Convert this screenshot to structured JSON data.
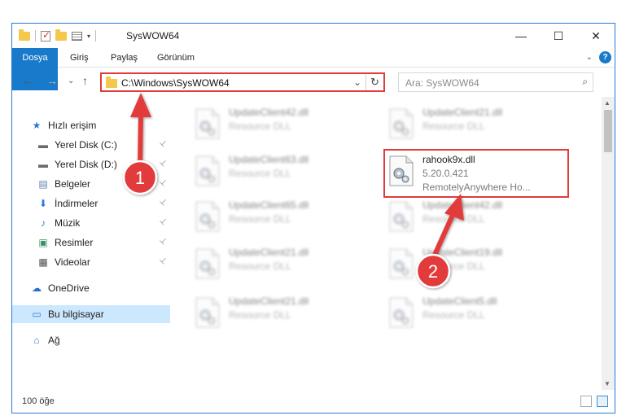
{
  "window": {
    "title": "SysWOW64",
    "controls": {
      "minimize": "—",
      "maximize": "☐",
      "close": "✕"
    }
  },
  "ribbon": {
    "tabs": [
      "Dosya",
      "Giriş",
      "Paylaş",
      "Görünüm"
    ],
    "expand_glyph": "⌄",
    "help_glyph": "?"
  },
  "nav": {
    "back": "←",
    "forward": "→",
    "recent": "⌄",
    "up": "↑"
  },
  "address": {
    "path": "C:\\Windows\\SysWOW64",
    "dropdown": "⌄",
    "refresh": "↻"
  },
  "search": {
    "placeholder": "Ara: SysWOW64",
    "icon": "⌕"
  },
  "sidebar": {
    "items": [
      {
        "label": "Hızlı erişim",
        "icon": "star-icon",
        "glyph": "★",
        "color": "#2b79d8",
        "pinned": false
      },
      {
        "label": "Yerel Disk (C:)",
        "icon": "drive-icon",
        "glyph": "▬",
        "color": "#6a6a6a",
        "pinned": true
      },
      {
        "label": "Yerel Disk (D:)",
        "icon": "drive-icon",
        "glyph": "▬",
        "color": "#6a6a6a",
        "pinned": true
      },
      {
        "label": "Belgeler",
        "icon": "documents-icon",
        "glyph": "▤",
        "color": "#5a7fb0",
        "pinned": true
      },
      {
        "label": "İndirmeler",
        "icon": "download-icon",
        "glyph": "⬇",
        "color": "#2b79d8",
        "pinned": true
      },
      {
        "label": "Müzik",
        "icon": "music-icon",
        "glyph": "♪",
        "color": "#2b79d8",
        "pinned": true
      },
      {
        "label": "Resimler",
        "icon": "pictures-icon",
        "glyph": "▣",
        "color": "#3b8f6a",
        "pinned": true
      },
      {
        "label": "Videolar",
        "icon": "videos-icon",
        "glyph": "▦",
        "color": "#4a4a4a",
        "pinned": true
      },
      {
        "label": "OneDrive",
        "icon": "cloud-icon",
        "glyph": "☁",
        "color": "#1e6fd0",
        "pinned": false
      },
      {
        "label": "Bu bilgisayar",
        "icon": "computer-icon",
        "glyph": "▭",
        "color": "#2b79d8",
        "pinned": false,
        "selected": true
      },
      {
        "label": "Ağ",
        "icon": "network-icon",
        "glyph": "⌂",
        "color": "#2b79d8",
        "pinned": false
      }
    ],
    "pin_glyph": "📌"
  },
  "files": [
    {
      "name": "UpdateClient42.dll",
      "line2": "Resource DLL",
      "line3": "",
      "blurred": true
    },
    {
      "name": "UpdateClient21.dll",
      "line2": "Resource DLL",
      "line3": "",
      "blurred": true
    },
    {
      "name": "UpdateClient63.dll",
      "line2": "Resource DLL",
      "line3": "",
      "blurred": true
    },
    {
      "name": "rahook9x.dll",
      "line2": "5.20.0.421",
      "line3": "RemotelyAnywhere Ho...",
      "blurred": false,
      "highlighted": true
    },
    {
      "name": "UpdateClient65.dll",
      "line2": "Resource DLL",
      "line3": "",
      "blurred": true
    },
    {
      "name": "UpdateClient42.dll",
      "line2": "Resource DLL",
      "line3": "",
      "blurred": true
    },
    {
      "name": "UpdateClient21.dll",
      "line2": "Resource DLL",
      "line3": "",
      "blurred": true
    },
    {
      "name": "UpdateClient19.dll",
      "line2": "Resource DLL",
      "line3": "",
      "blurred": true
    },
    {
      "name": "UpdateClient21.dll",
      "line2": "Resource DLL",
      "line3": "",
      "blurred": true
    },
    {
      "name": "UpdateClient5.dll",
      "line2": "Resource DLL",
      "line3": "",
      "blurred": true
    }
  ],
  "status": {
    "count": "100 öğe"
  },
  "annotations": [
    {
      "number": "1",
      "color": "#e23b3b"
    },
    {
      "number": "2",
      "color": "#e23b3b"
    }
  ]
}
